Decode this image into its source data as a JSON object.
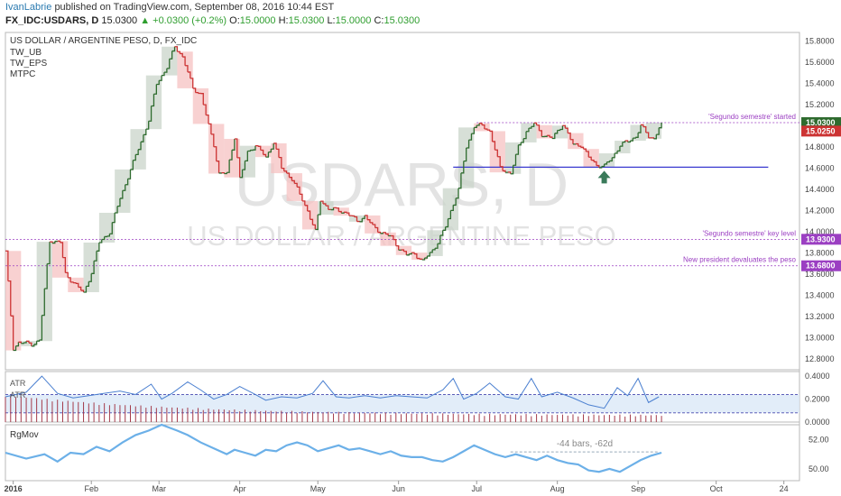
{
  "header": {
    "author": "IvanLabrie",
    "published_text": "published on TradingView.com, September 08, 2016 10:44 EST",
    "symbol": "FX_IDC:USDARS, D",
    "last": "15.0300",
    "change": "+0.0300 (+0.2%)",
    "open_label": "O:",
    "open": "15.0000",
    "high_label": "H:",
    "high": "15.0300",
    "low_label": "L:",
    "low": "15.0000",
    "close_label": "C:",
    "close": "15.0300"
  },
  "watermark": {
    "ticker": "USDARS, D",
    "name": "US DOLLAR / ARGENTINE PESO"
  },
  "legend": {
    "title": "US DOLLAR / ARGENTINE PESO, D, FX_IDC",
    "studies": [
      "TW_UB",
      "TW_EPS",
      "MTPC"
    ]
  },
  "colors": {
    "up": "#2e6b2e",
    "down": "#cc3333",
    "box_up": "#c9d4c9",
    "box_down": "#f5c2c2",
    "level": "#9b3fc2",
    "support": "#3a3ad0",
    "atr": "#4a7fd0",
    "vol": "#a33a4a",
    "rgmov": "#6cb0e8",
    "arrow": "#3a7a5a"
  },
  "chart_data": [
    {
      "type": "line",
      "name_text": "US DOLLAR / ARGENTINE PESO, D, FX_IDC",
      "x_ticks": [
        "2016",
        "Feb",
        "Mar",
        "Apr",
        "May",
        "Jun",
        "Jul",
        "Aug",
        "Sep",
        "Oct",
        "24"
      ],
      "x_tick_index": [
        3,
        33,
        59,
        90,
        120,
        151,
        181,
        212,
        243,
        273,
        299
      ],
      "x_range": [
        0,
        305
      ],
      "y_ticks": [
        12.8,
        13.0,
        13.2,
        13.4,
        13.6,
        13.8,
        14.0,
        14.2,
        14.4,
        14.6,
        14.8,
        15.0,
        15.2,
        15.4,
        15.6,
        15.8
      ],
      "ylim": [
        12.7,
        15.88
      ],
      "close_keypoints": [
        [
          0,
          13.82
        ],
        [
          3,
          12.9
        ],
        [
          5,
          12.96
        ],
        [
          10,
          12.94
        ],
        [
          13,
          12.98
        ],
        [
          17,
          13.92
        ],
        [
          21,
          13.9
        ],
        [
          23,
          13.6
        ],
        [
          27,
          13.5
        ],
        [
          30,
          13.42
        ],
        [
          33,
          13.62
        ],
        [
          36,
          13.9
        ],
        [
          40,
          14.0
        ],
        [
          44,
          14.32
        ],
        [
          50,
          14.72
        ],
        [
          55,
          15.05
        ],
        [
          58,
          15.4
        ],
        [
          62,
          15.55
        ],
        [
          65,
          15.75
        ],
        [
          68,
          15.65
        ],
        [
          72,
          15.35
        ],
        [
          75,
          15.3
        ],
        [
          78,
          15.0
        ],
        [
          80,
          14.82
        ],
        [
          82,
          14.55
        ],
        [
          85,
          14.55
        ],
        [
          88,
          14.9
        ],
        [
          90,
          14.5
        ],
        [
          93,
          14.75
        ],
        [
          96,
          14.82
        ],
        [
          100,
          14.7
        ],
        [
          103,
          14.85
        ],
        [
          106,
          14.6
        ],
        [
          110,
          14.5
        ],
        [
          113,
          14.35
        ],
        [
          116,
          14.2
        ],
        [
          119,
          14.0
        ],
        [
          121,
          14.3
        ],
        [
          124,
          14.22
        ],
        [
          128,
          14.2
        ],
        [
          131,
          14.18
        ],
        [
          135,
          14.1
        ],
        [
          138,
          14.15
        ],
        [
          141,
          14.05
        ],
        [
          144,
          14.0
        ],
        [
          148,
          13.95
        ],
        [
          151,
          13.85
        ],
        [
          154,
          13.78
        ],
        [
          157,
          13.8
        ],
        [
          160,
          13.72
        ],
        [
          163,
          13.8
        ],
        [
          166,
          13.9
        ],
        [
          169,
          14.05
        ],
        [
          171,
          14.2
        ],
        [
          174,
          14.4
        ],
        [
          177,
          14.8
        ],
        [
          180,
          15.0
        ],
        [
          183,
          15.0
        ],
        [
          186,
          14.95
        ],
        [
          190,
          14.6
        ],
        [
          194,
          14.55
        ],
        [
          197,
          14.8
        ],
        [
          200,
          14.95
        ],
        [
          203,
          15.02
        ],
        [
          206,
          14.92
        ],
        [
          210,
          14.88
        ],
        [
          214,
          15.02
        ],
        [
          218,
          14.82
        ],
        [
          221,
          14.82
        ],
        [
          224,
          14.7
        ],
        [
          227,
          14.63
        ],
        [
          230,
          14.62
        ],
        [
          233,
          14.7
        ],
        [
          236,
          14.82
        ],
        [
          239,
          14.85
        ],
        [
          242,
          14.9
        ],
        [
          244,
          15.0
        ],
        [
          247,
          14.9
        ],
        [
          249,
          14.88
        ],
        [
          251,
          14.98
        ],
        [
          252,
          15.03
        ]
      ],
      "levels": [
        {
          "value": 15.03,
          "label": "'Segundo semestre' started",
          "price": "15.0300",
          "from_index": 181
        },
        {
          "value": 13.93,
          "label": "'Segundo semestre' key level",
          "price": "13.9300",
          "from_index": 0
        },
        {
          "value": 13.68,
          "label": "New president devaluates the peso",
          "price": "13.6800",
          "from_index": 0
        }
      ],
      "support": {
        "value": 14.61,
        "from_index": 172,
        "to_index": 293
      },
      "price_labels": [
        {
          "value": 15.03,
          "text": "15.0300"
        },
        {
          "value": 14.95,
          "text": "15.0250"
        }
      ],
      "arrow_index": 230
    },
    {
      "type": "line",
      "name_text": "ATR",
      "band_label": "ATR",
      "y_ticks": [
        0.0,
        0.2,
        0.4
      ],
      "ylim": [
        0,
        0.44
      ],
      "band": [
        0.08,
        0.24
      ],
      "atr_keypoints": [
        [
          0,
          0.22
        ],
        [
          8,
          0.26
        ],
        [
          14,
          0.4
        ],
        [
          20,
          0.25
        ],
        [
          26,
          0.21
        ],
        [
          32,
          0.23
        ],
        [
          38,
          0.25
        ],
        [
          44,
          0.27
        ],
        [
          50,
          0.24
        ],
        [
          56,
          0.33
        ],
        [
          60,
          0.2
        ],
        [
          64,
          0.25
        ],
        [
          70,
          0.35
        ],
        [
          75,
          0.28
        ],
        [
          80,
          0.2
        ],
        [
          85,
          0.24
        ],
        [
          90,
          0.31
        ],
        [
          96,
          0.24
        ],
        [
          100,
          0.19
        ],
        [
          106,
          0.22
        ],
        [
          112,
          0.21
        ],
        [
          118,
          0.25
        ],
        [
          122,
          0.36
        ],
        [
          127,
          0.22
        ],
        [
          132,
          0.21
        ],
        [
          138,
          0.23
        ],
        [
          144,
          0.21
        ],
        [
          150,
          0.23
        ],
        [
          156,
          0.22
        ],
        [
          162,
          0.21
        ],
        [
          168,
          0.28
        ],
        [
          172,
          0.38
        ],
        [
          176,
          0.2
        ],
        [
          181,
          0.25
        ],
        [
          186,
          0.34
        ],
        [
          192,
          0.22
        ],
        [
          197,
          0.2
        ],
        [
          202,
          0.38
        ],
        [
          206,
          0.22
        ],
        [
          212,
          0.26
        ],
        [
          218,
          0.21
        ],
        [
          224,
          0.15
        ],
        [
          230,
          0.12
        ],
        [
          235,
          0.3
        ],
        [
          239,
          0.23
        ],
        [
          243,
          0.38
        ],
        [
          247,
          0.17
        ],
        [
          251,
          0.22
        ]
      ]
    },
    {
      "type": "line",
      "name_text": "RgMov",
      "y_ticks": [
        50.0,
        52.0
      ],
      "ylim": [
        49.2,
        53.0
      ],
      "annotation": "-44 bars, -62d",
      "annotation_from_index": 194,
      "annotation_to_index": 251,
      "annotation_value": 51.15,
      "rgmov_keypoints": [
        [
          0,
          51.1
        ],
        [
          8,
          50.7
        ],
        [
          15,
          51.0
        ],
        [
          20,
          50.5
        ],
        [
          25,
          51.1
        ],
        [
          30,
          51.0
        ],
        [
          35,
          51.5
        ],
        [
          40,
          51.2
        ],
        [
          45,
          51.8
        ],
        [
          50,
          52.3
        ],
        [
          55,
          52.6
        ],
        [
          60,
          53.0
        ],
        [
          63,
          52.8
        ],
        [
          66,
          52.6
        ],
        [
          70,
          52.3
        ],
        [
          75,
          51.8
        ],
        [
          80,
          51.4
        ],
        [
          85,
          51.0
        ],
        [
          88,
          51.3
        ],
        [
          92,
          51.1
        ],
        [
          96,
          50.9
        ],
        [
          100,
          51.3
        ],
        [
          104,
          51.2
        ],
        [
          108,
          51.6
        ],
        [
          112,
          51.8
        ],
        [
          116,
          51.6
        ],
        [
          120,
          51.2
        ],
        [
          124,
          51.4
        ],
        [
          128,
          51.6
        ],
        [
          132,
          51.3
        ],
        [
          136,
          51.4
        ],
        [
          140,
          51.2
        ],
        [
          144,
          51.0
        ],
        [
          148,
          51.2
        ],
        [
          152,
          50.9
        ],
        [
          156,
          50.8
        ],
        [
          160,
          50.8
        ],
        [
          164,
          50.6
        ],
        [
          168,
          50.5
        ],
        [
          172,
          50.8
        ],
        [
          176,
          51.2
        ],
        [
          180,
          51.6
        ],
        [
          184,
          51.3
        ],
        [
          188,
          51.0
        ],
        [
          192,
          50.8
        ],
        [
          196,
          51.0
        ],
        [
          200,
          50.8
        ],
        [
          204,
          50.6
        ],
        [
          208,
          50.9
        ],
        [
          212,
          50.6
        ],
        [
          216,
          50.4
        ],
        [
          220,
          50.3
        ],
        [
          224,
          49.9
        ],
        [
          228,
          49.8
        ],
        [
          232,
          50.0
        ],
        [
          236,
          49.8
        ],
        [
          240,
          50.2
        ],
        [
          244,
          50.6
        ],
        [
          248,
          50.9
        ],
        [
          252,
          51.1
        ]
      ]
    }
  ]
}
